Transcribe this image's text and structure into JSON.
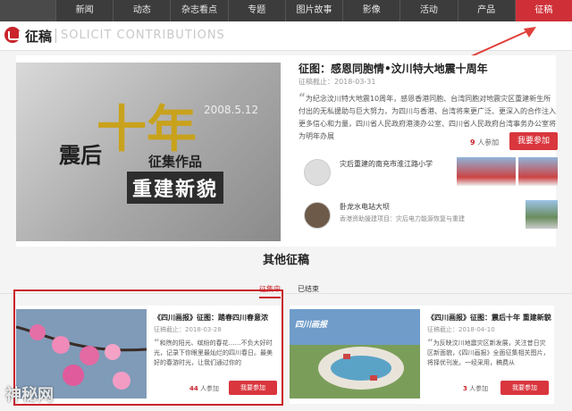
{
  "nav": {
    "items": [
      "新闻",
      "动态",
      "杂志看点",
      "专题",
      "图片故事",
      "影像",
      "活动",
      "产品",
      "征稿"
    ],
    "active_index": 8,
    "active_color": "#cf3038"
  },
  "section": {
    "title_cn": "征稿",
    "title_en": "SOLICIT CONTRIBUTIONS",
    "icon": "magazine-logo-icon"
  },
  "featured": {
    "hero": {
      "big_char": "十年",
      "small_chars": "震后",
      "date_stamp": "2008.5.12",
      "subtitle": "征集作品",
      "title": "重建新貌"
    },
    "title": "征图：感恩同胞情•汶川特大地震十周年",
    "deadline": "征稿截止：2018-03-31",
    "description": "为纪念汶川特大地震10周年，感恩香港同胞、台湾同胞对地震灾区重建新生所付出的无私援助与巨大努力，为四川与香港、台湾将来更广泛、更深入的合作注入更多信心和力量，四川省人民政府港澳办公室、四川省人民政府台湾事务办公室将为明年办展",
    "count": "9",
    "count_suffix": "人参加",
    "join_label": "我要参加",
    "candidates": [
      {
        "text": "灾后重建的南充市淮江路小学",
        "sub": ""
      },
      {
        "text": "卧龙水电站大坝",
        "sub": "香港资助援建项目：灾后电力能源恢复与重建"
      }
    ]
  },
  "others": {
    "heading": "其他征稿",
    "tabs": [
      "征集中",
      "已结束"
    ],
    "active_tab": 0,
    "cards": [
      {
        "title": "《四川画报》征图：踏春四川春意浓",
        "deadline": "征稿截止：2018-03-28",
        "description": "和煦的阳光、缤纷的春花……不负大好时光，记录下你眼里最灿烂的四川春日。最美好的春游时光，让我们通过你的",
        "count": "44",
        "count_suffix": "人参加",
        "join_label": "我要参加"
      },
      {
        "title": "《四川画报》征图：震后十年 重建新貌",
        "deadline": "征稿截止：2018-04-10",
        "description": "为反映汶川地震灾区新发展，关注昔日灾区新面貌，《四川画报》全面征集相关图片，将择优刊发。一经采用，稿费从",
        "count": "3",
        "count_suffix": "人参加",
        "join_label": "我要参加",
        "logo_text": "四川画报"
      }
    ]
  },
  "watermark": "神秘网"
}
